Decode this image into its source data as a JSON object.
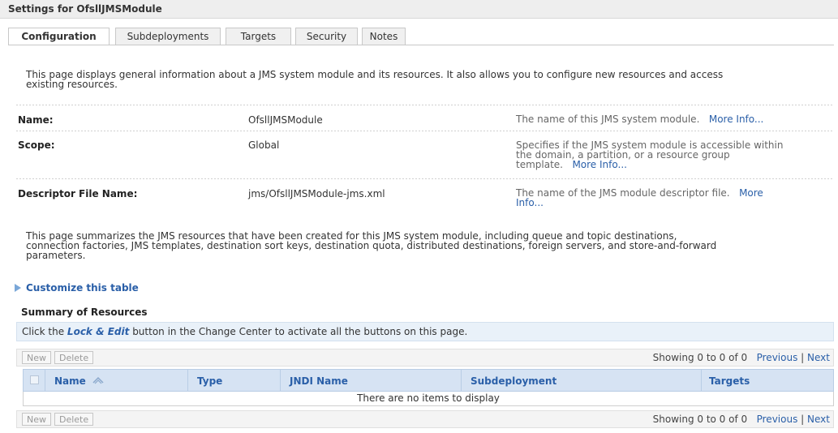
{
  "page": {
    "title": "Settings for OfsllJMSModule"
  },
  "tabs": [
    {
      "label": "Configuration",
      "active": true
    },
    {
      "label": "Subdeployments",
      "active": false
    },
    {
      "label": "Targets",
      "active": false
    },
    {
      "label": "Security",
      "active": false
    },
    {
      "label": "Notes",
      "active": false
    }
  ],
  "intro": {
    "line1": "This page displays general information about a JMS system module and its resources. It also allows you to configure new resources and access",
    "line2": "existing resources."
  },
  "fields": {
    "name": {
      "label": "Name:",
      "value": "OfsllJMSModule",
      "help": "The name of this JMS system module.",
      "more": "More Info..."
    },
    "scope": {
      "label": "Scope:",
      "value": "Global",
      "help_line1": "Specifies if the JMS system module is accessible within",
      "help_line2": "the domain, a partition, or a resource group",
      "help_line3": "template.",
      "more": "More Info..."
    },
    "descriptor": {
      "label": "Descriptor File Name:",
      "value": "jms/OfsllJMSModule-jms.xml",
      "help_line1": "The name of the JMS module descriptor file.",
      "more1": "More",
      "more2": "Info..."
    }
  },
  "summary_text": {
    "line1": "This page summarizes the JMS resources that have been created for this JMS system module, including queue and topic destinations,",
    "line2": "connection factories, JMS templates, destination sort keys, destination quota, distributed destinations, foreign servers, and store-and-forward",
    "line3": "parameters."
  },
  "customize": {
    "label": "Customize this table"
  },
  "resources": {
    "title": "Summary of Resources",
    "lock_before": "Click the ",
    "lock_emph": "Lock & Edit",
    "lock_after": " button in the Change Center to activate all the buttons on this page.",
    "buttons": {
      "new": "New",
      "delete": "Delete"
    },
    "paging": {
      "showing": "Showing 0 to 0 of 0",
      "previous": "Previous",
      "sep": "|",
      "next": "Next"
    },
    "columns": [
      "Name",
      "Type",
      "JNDI Name",
      "Subdeployment",
      "Targets"
    ],
    "sort_indicator": "sort-ascending-icon",
    "empty_message": "There are no items to display"
  },
  "colors": {
    "link": "#2a5fa8",
    "header_bg": "#d6e3f3",
    "lock_bar_bg": "#e9f1f9"
  }
}
